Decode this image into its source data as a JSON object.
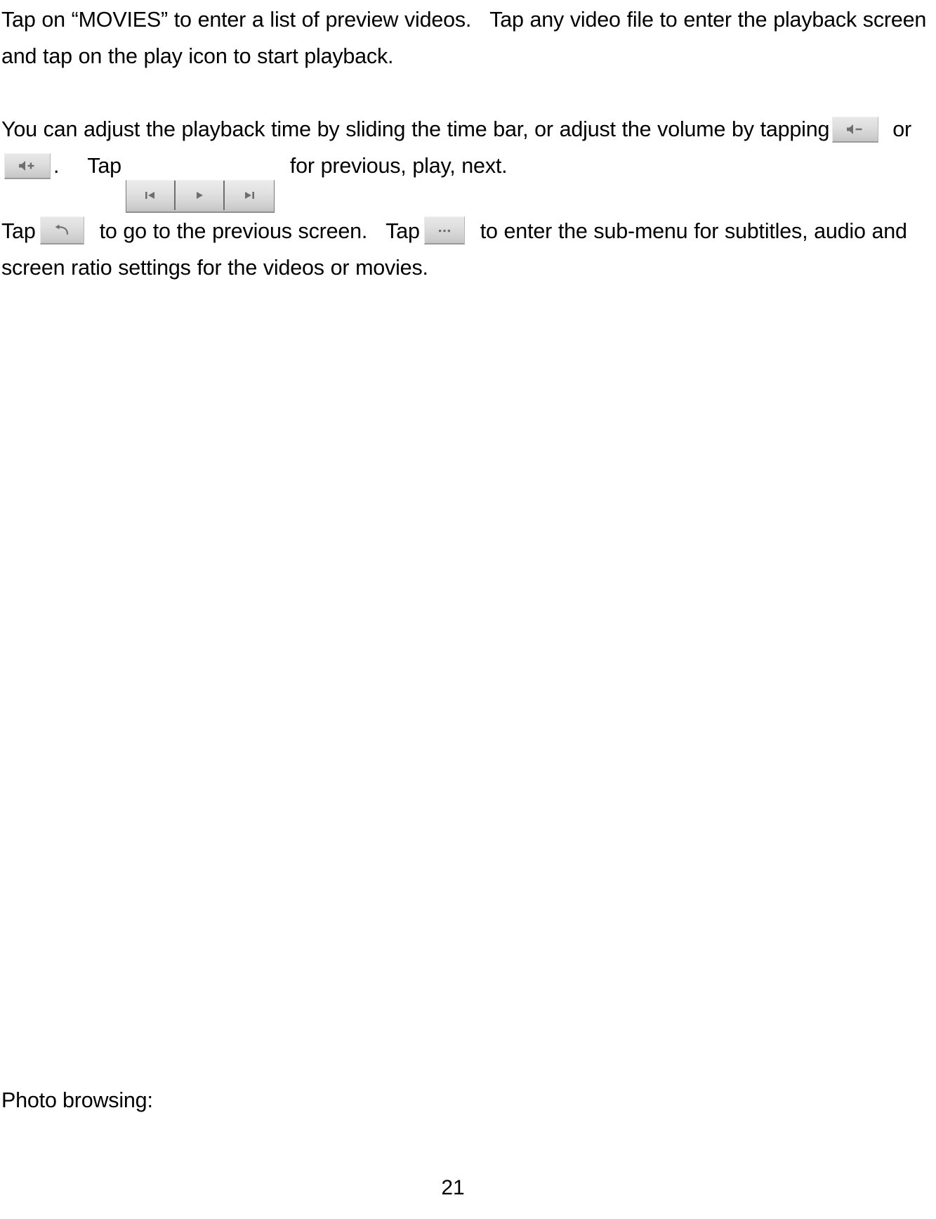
{
  "document": {
    "page_number": "21",
    "paragraphs": {
      "p1_part1": "Tap on “MOVIES” to enter a list of preview videos.",
      "p1_part2": "Tap any video file to enter the playback screen and tap on the play icon to start playback.",
      "p2_seg1": "You can adjust the playback time by sliding the time bar, or adjust the volume by tapping",
      "p2_seg2": "or",
      "p2_seg3": ".",
      "p2_seg4": "Tap",
      "p2_seg5": "for previous, play, next.",
      "p2_seg6": "Tap",
      "p2_seg7": "to go to the previous screen.",
      "p2_seg8": "Tap",
      "p2_seg9": "to enter the sub-menu for subtitles, audio and screen ratio settings for the videos or movies."
    },
    "photo_browsing_heading": "Photo browsing:",
    "icons": {
      "volume_down": "volume-down-icon",
      "volume_up": "volume-up-icon",
      "previous": "previous-track-icon",
      "play": "play-icon",
      "next": "next-track-icon",
      "back": "back-arrow-icon",
      "menu": "more-options-icon"
    },
    "colors": {
      "page_background": "#ffffff",
      "text": "#000000",
      "button_face": "#dcdcdc",
      "button_glyph": "#6e6e6e",
      "button_border": "#8f8f8f"
    }
  }
}
